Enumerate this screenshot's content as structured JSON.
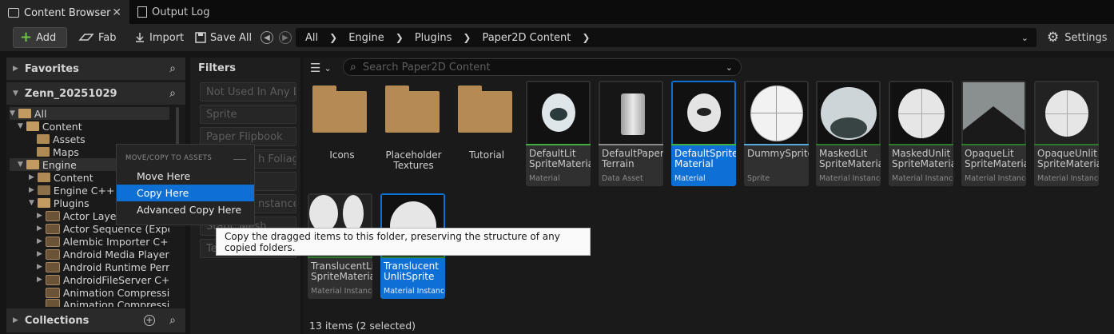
{
  "tabs": [
    {
      "label": "Content Browser",
      "close": "✕"
    },
    {
      "label": "Output Log"
    }
  ],
  "toolbar": {
    "add": "Add",
    "fab": "Fab",
    "import": "Import",
    "save_all": "Save All",
    "settings": "Settings"
  },
  "path": [
    "All",
    "Engine",
    "Plugins",
    "Paper2D Content"
  ],
  "favorites": {
    "title": "Favorites"
  },
  "project": {
    "title": "Zenn_20251029"
  },
  "tree": [
    "All",
    "Content",
    "Assets",
    "Maps",
    "Engine",
    "Content",
    "Engine C++ Classes",
    "Plugins",
    "Actor Layer",
    "Actor Sequence (Experimental)",
    "Alembic Importer C++ Classes",
    "Android Media Player C++",
    "Android Runtime Permission",
    "AndroidFileServer C++ C",
    "Animation Compression",
    "Animation Compression"
  ],
  "collections": {
    "title": "Collections"
  },
  "filters": {
    "title": "Filters",
    "chips": [
      "Not Used In Any Le",
      "Sprite",
      "Paper Flipbook",
      "Foliage",
      "",
      "Instance",
      "Mesh",
      "Te"
    ],
    "chip_visible": [
      "Not Used In Any Le",
      "Sprite",
      "Paper Flipbook",
      "h Foliage",
      "",
      "nstance",
      "Static Mesh",
      "Te"
    ]
  },
  "search": {
    "placeholder": "Search Paper2D Content"
  },
  "folders": [
    {
      "name": "Icons"
    },
    {
      "name": "Placeholder\nTextures"
    },
    {
      "name": "Tutorial"
    }
  ],
  "assets": [
    {
      "name": "DefaultLit\nSpriteMaterial",
      "type": "Material",
      "bar": "#3fae3f"
    },
    {
      "name": "DefaultPaper\nTerrain",
      "type": "Data Asset",
      "bar": "#8a8a8a"
    },
    {
      "name": "DefaultSprite\nMaterial",
      "type": "Material",
      "bar": "#3fae3f"
    },
    {
      "name": "DummySprite",
      "type": "Sprite",
      "bar": "#55aadd"
    },
    {
      "name": "MaskedLit\nSpriteMaterial",
      "type": "Material Instance",
      "bar": "#2a7a2a"
    },
    {
      "name": "MaskedUnlit\nSpriteMaterial",
      "type": "Material Instance",
      "bar": "#2a7a2a"
    },
    {
      "name": "OpaqueLit\nSpriteMaterial",
      "type": "Material Instance",
      "bar": "#2a7a2a"
    },
    {
      "name": "OpaqueUnlit\nSpriteMaterial",
      "type": "Material Instance",
      "bar": "#2a7a2a"
    },
    {
      "name": "TranslucentLit\nSpriteMaterial",
      "type": "Material Instance",
      "bar": "#2a7a2a"
    },
    {
      "name": "Translucent\nUnlitSprite",
      "type": "Material Instance",
      "bar": "#2a7a2a"
    }
  ],
  "context_menu": {
    "header": "MOVE/COPY TO ASSETS",
    "items": [
      "Move Here",
      "Copy Here",
      "Advanced Copy Here"
    ]
  },
  "tooltip": "Copy the dragged items to this folder, preserving the structure of any copied folders.",
  "status": "13 items (2 selected)",
  "colors": {
    "accent": "#0e6fd4",
    "add_plus": "#6fc04a",
    "folder": "#b68a54"
  }
}
